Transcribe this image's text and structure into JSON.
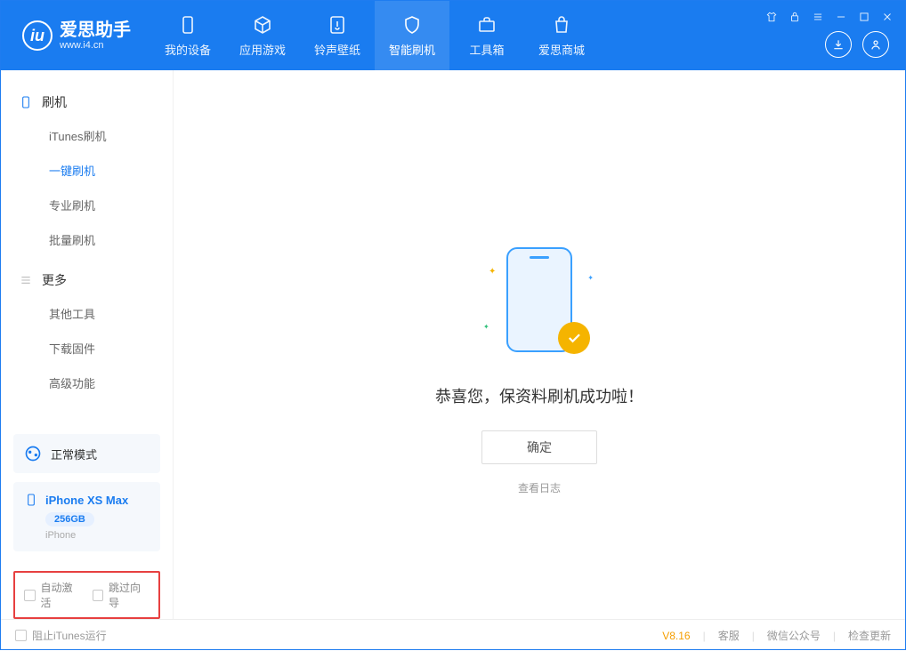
{
  "app": {
    "name": "爱思助手",
    "url": "www.i4.cn"
  },
  "nav": [
    {
      "label": "我的设备"
    },
    {
      "label": "应用游戏"
    },
    {
      "label": "铃声壁纸"
    },
    {
      "label": "智能刷机"
    },
    {
      "label": "工具箱"
    },
    {
      "label": "爱思商城"
    }
  ],
  "sidebar": {
    "sections": [
      {
        "title": "刷机",
        "items": [
          "iTunes刷机",
          "一键刷机",
          "专业刷机",
          "批量刷机"
        ],
        "active": 1
      },
      {
        "title": "更多",
        "items": [
          "其他工具",
          "下载固件",
          "高级功能"
        ]
      }
    ],
    "mode": "正常模式",
    "device": {
      "name": "iPhone XS Max",
      "storage": "256GB",
      "sub": "iPhone"
    },
    "checks": [
      "自动激活",
      "跳过向导"
    ]
  },
  "main": {
    "message": "恭喜您，保资料刷机成功啦！",
    "ok": "确定",
    "log": "查看日志"
  },
  "footer": {
    "block": "阻止iTunes运行",
    "version": "V8.16",
    "links": [
      "客服",
      "微信公众号",
      "检查更新"
    ]
  }
}
